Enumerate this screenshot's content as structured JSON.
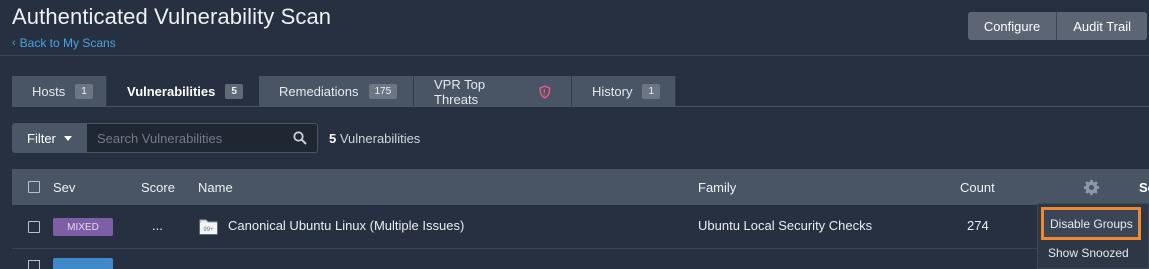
{
  "header": {
    "title": "Authenticated Vulnerability Scan",
    "back_link": "Back to My Scans",
    "buttons": [
      "Configure",
      "Audit Trail"
    ]
  },
  "tabs": [
    {
      "label": "Hosts",
      "badge": "1"
    },
    {
      "label": "Vulnerabilities",
      "badge": "5"
    },
    {
      "label": "Remediations",
      "badge": "175"
    },
    {
      "label": "VPR Top Threats",
      "badge": ""
    },
    {
      "label": "History",
      "badge": "1"
    }
  ],
  "filter": {
    "label": "Filter",
    "search_placeholder": "Search Vulnerabilities",
    "count_number": "5",
    "count_label": "Vulnerabilities"
  },
  "table": {
    "columns": [
      "Sev",
      "Score",
      "Name",
      "Family",
      "Count"
    ],
    "cut_column": "Se",
    "rows": [
      {
        "sev": "MIXED",
        "score": "...",
        "icon_badge": "99+",
        "name": "Canonical Ubuntu Linux (Multiple Issues)",
        "family": "Ubuntu Local Security Checks",
        "count": "274"
      }
    ]
  },
  "menu": {
    "items": [
      "Disable Groups",
      "Show Snoozed"
    ]
  },
  "colors": {
    "background": "#263040",
    "accent_blue": "#4ba3e0",
    "highlight_orange": "#f1892e",
    "mixed_purple": "#7c5fa5"
  }
}
